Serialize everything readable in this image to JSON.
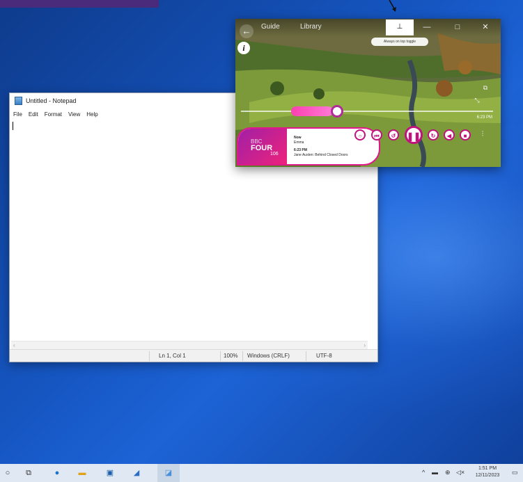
{
  "notepad": {
    "title": "Untitled - Notepad",
    "menu": [
      "File",
      "Edit",
      "Format",
      "View",
      "Help"
    ],
    "status": {
      "position": "Ln 1, Col 1",
      "zoom": "100%",
      "line_endings": "Windows (CRLF)",
      "encoding": "UTF-8"
    }
  },
  "player": {
    "tabs": [
      "Guide",
      "Library"
    ],
    "pin_tooltip": "Always on top toggle",
    "time": "6:23 PM",
    "station": {
      "line1": "BBC",
      "line2": "FOUR",
      "line3": "106"
    },
    "now": {
      "label": "Now",
      "title": "Emma",
      "time": "6:23 PM",
      "next": "Jane Austen: Behind Closed Doors"
    }
  },
  "taskbar": {
    "clock_time": "1:51 PM",
    "clock_date": "12/11/2023"
  }
}
